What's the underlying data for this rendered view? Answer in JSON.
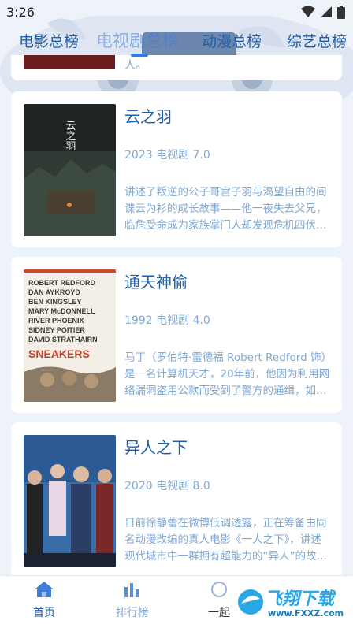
{
  "status_bar": {
    "time": "3:26"
  },
  "tabs": [
    {
      "label": "电影总榜"
    },
    {
      "label": "电视剧总榜"
    },
    {
      "label": "动漫总榜"
    },
    {
      "label": "综艺总榜"
    }
  ],
  "partial_card": {
    "text": "人。"
  },
  "cards": [
    {
      "title": "云之羽",
      "meta": "2023 电视剧 7.0",
      "description": "讲述了叛逆的公子哥宫子羽与渴望自由的间谍云为衫的成长故事——他一夜失去父兄，临危受命成为家族掌门人却发现危机四伏，她被派来潜伏在他身边，…",
      "poster_text": "云之羽"
    },
    {
      "title": "通天神偷",
      "meta": "1992 电视剧 4.0",
      "description": "马丁（罗伯特·雷德福 Robert Redford 饰）是一名计算机天才，20年前，他因为利用网络漏洞盗用公款而受到了警方的通缉，如今，他早已经金盆洗手改…",
      "poster_names": [
        "ROBERT REDFORD",
        "DAN AYKROYD",
        "BEN KINGSLEY",
        "MARY McDONNELL",
        "RIVER PHOENIX",
        "SIDNEY POITIER",
        "DAVID STRATHAIRN"
      ],
      "poster_title": "SNEAKERS"
    },
    {
      "title": "异人之下",
      "meta": "2020 电视剧 8.0",
      "description": "日前徐静蕾在微博低调透露，正在筹备由同名动漫改编的真人电影《一人之下》，讲述现代城市中一群拥有超能力的“异人”的故事，这群人外表看起来…"
    }
  ],
  "bottom_nav": [
    {
      "label": "首页",
      "icon": "home-icon"
    },
    {
      "label": "排行榜",
      "icon": "bar-chart-icon"
    },
    {
      "label": "一起",
      "icon": "circle-icon"
    }
  ],
  "watermark": {
    "text": "飞翔下载",
    "url": "www.FXXZ.com"
  },
  "colors": {
    "accent": "#1f5fa8",
    "muted": "#7fa8d4",
    "active_nav": "#2f7fe0"
  }
}
